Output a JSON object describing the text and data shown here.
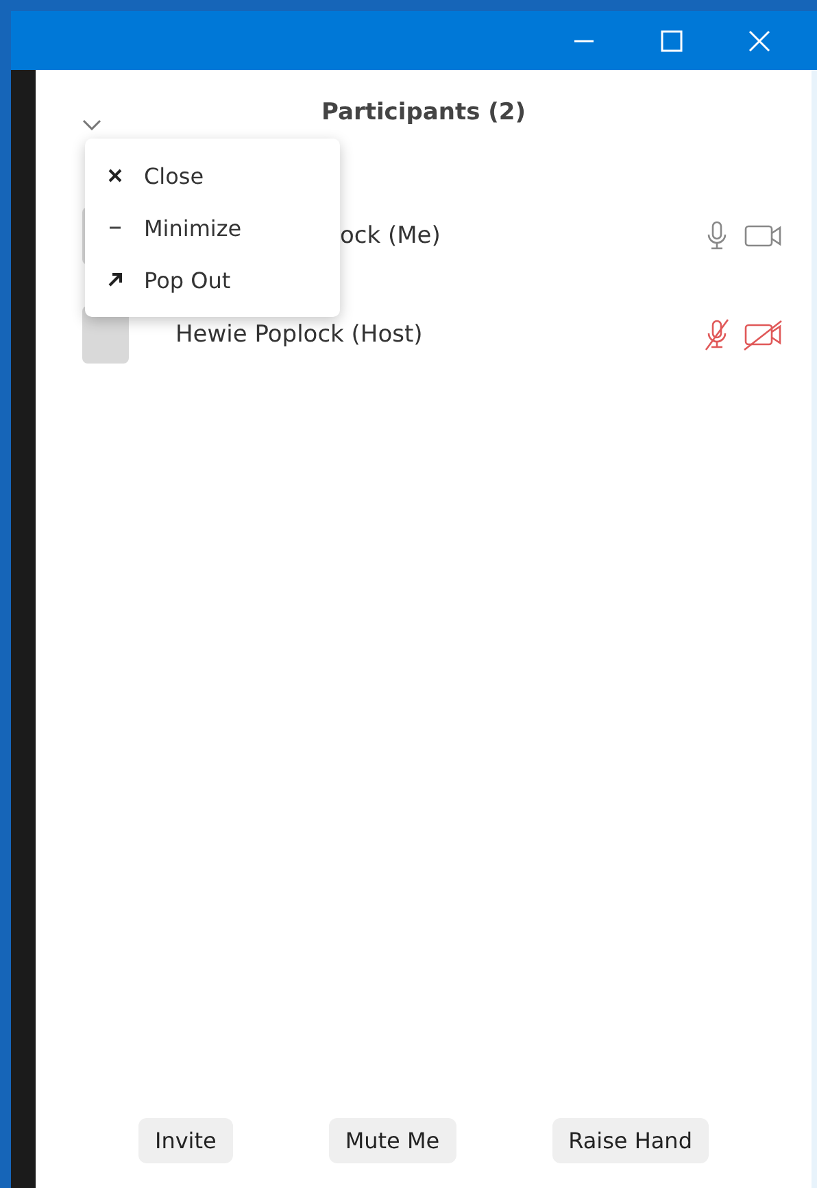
{
  "panel": {
    "title": "Participants (2)"
  },
  "menu": [
    {
      "kind": "close",
      "label": "Close"
    },
    {
      "kind": "minimize",
      "label": "Minimize"
    },
    {
      "kind": "popout",
      "label": "Pop Out"
    }
  ],
  "participants": [
    {
      "name": "ock (Me)",
      "covered": true,
      "audio_muted": false,
      "video_muted": false
    },
    {
      "name": "Hewie Poplock (Host)",
      "covered": false,
      "audio_muted": true,
      "video_muted": true
    }
  ],
  "buttons": [
    "Invite",
    "Mute Me",
    "Raise Hand"
  ]
}
